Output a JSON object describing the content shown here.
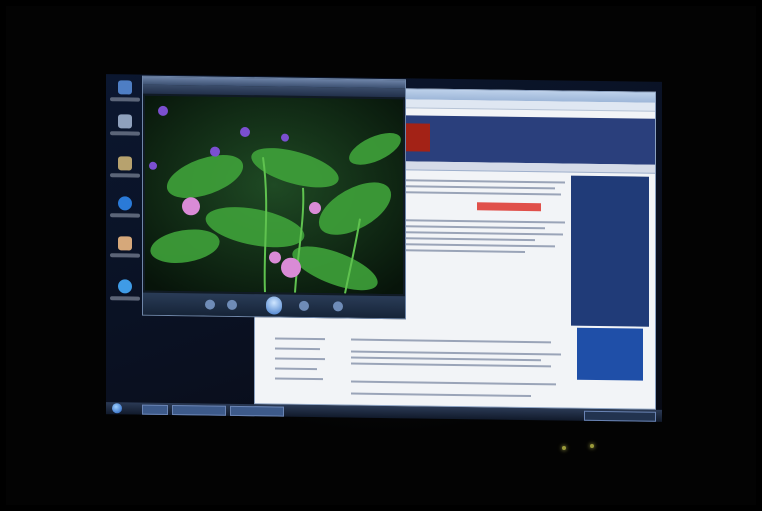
{
  "scene": {
    "subject": "",
    "colors": {
      "background": "#000000",
      "screen_wallpaper": "#0b1730",
      "browser_header": "#2a3f7c",
      "banner_red": "#b3281e",
      "cta_red": "#e0504a",
      "leaf_green": "#3fa23a",
      "flower_pink": "#d98bd6",
      "taskbar": "#1f2c44"
    }
  },
  "desktop_icons": [
    "computer-icon",
    "recycle-bin-icon",
    "folder-icon",
    "internet-explorer-icon",
    "photo-icon",
    "messenger-icon"
  ],
  "taskbar": {
    "items": [
      "start-orb-icon",
      "task-button",
      "task-button",
      "task-button"
    ]
  },
  "viewer": {
    "controls": [
      "previous-icon",
      "play-icon",
      "next-icon",
      "rotate-icon",
      "delete-icon"
    ]
  },
  "indicator_leds": 2
}
